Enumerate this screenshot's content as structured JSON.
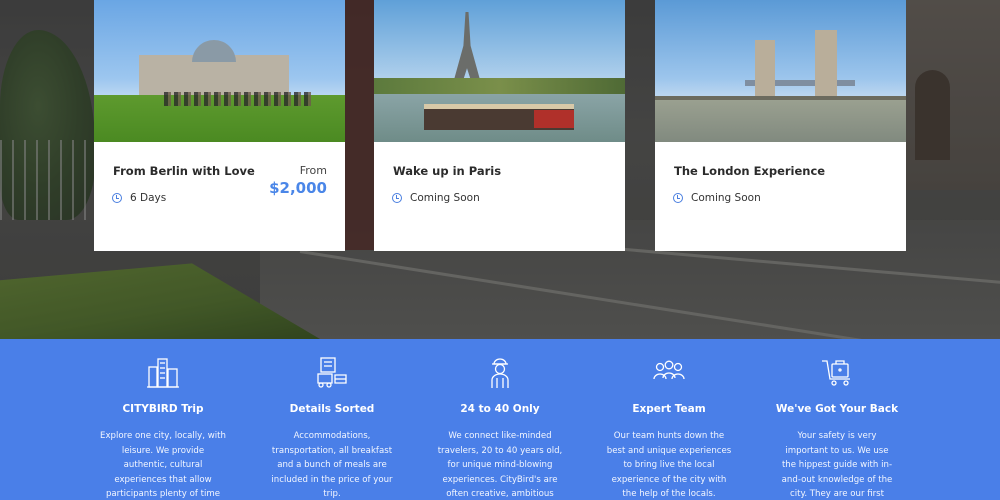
{
  "cards": [
    {
      "title": "From Berlin with Love",
      "meta": "6 Days",
      "from_label": "From",
      "price": "$2,000",
      "photo": "berlin-reichstag"
    },
    {
      "title": "Wake up in Paris",
      "meta": "Coming Soon",
      "photo": "paris-eiffel"
    },
    {
      "title": "The London Experience",
      "meta": "Coming Soon",
      "photo": "london-tower-bridge"
    }
  ],
  "features": [
    {
      "icon": "buildings-icon",
      "title": "CITYBIRD Trip",
      "desc": "Explore one city, locally, with leisure. We provide authentic, cultural experiences that allow participants plenty of time"
    },
    {
      "icon": "itinerary-icon",
      "title": "Details Sorted",
      "desc": "Accommodations, transportation, all breakfast and a bunch of meals are included in the price of your trip."
    },
    {
      "icon": "traveler-icon",
      "title": "24 to 40 Only",
      "desc": "We connect like-minded travelers, 20 to 40 years old, for unique mind-blowing experiences. CityBird's are often creative, ambitious"
    },
    {
      "icon": "team-icon",
      "title": "Expert Team",
      "desc": "Our team hunts down the best and unique experiences to bring live the local experience of the city with the help of the locals."
    },
    {
      "icon": "luggage-icon",
      "title": "We've Got Your Back",
      "desc": "Your safety is very important to us. We use the hippest guide with in-and-out knowledge of the city. They are our first point of"
    }
  ],
  "colors": {
    "accent": "#4a86e8",
    "band": "#4a7fe8"
  }
}
